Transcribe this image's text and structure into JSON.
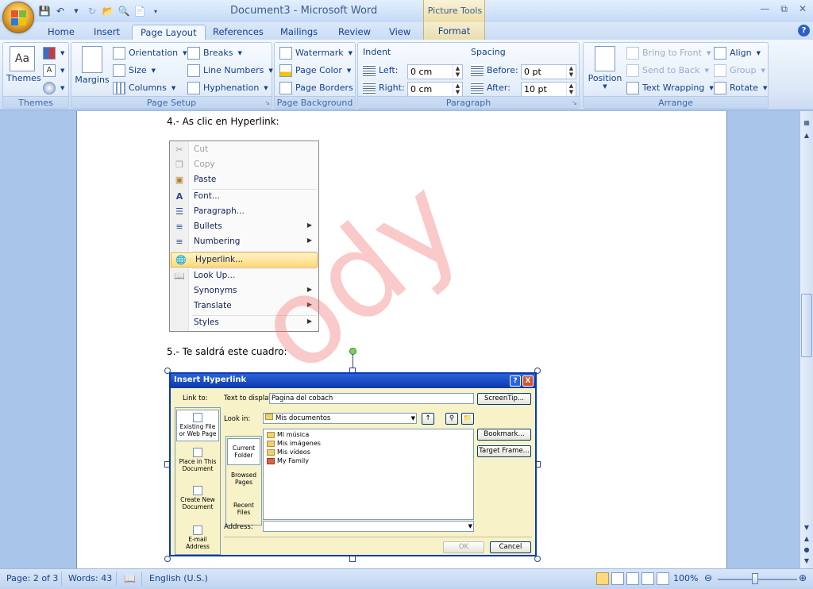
{
  "window": {
    "title": "Document3 - Microsoft Word",
    "contextual_tab_group": "Picture Tools"
  },
  "tabs": [
    "Home",
    "Insert",
    "Page Layout",
    "References",
    "Mailings",
    "Review",
    "View",
    "Format"
  ],
  "active_tab": "Page Layout",
  "ribbon": {
    "themes": {
      "label": "Themes",
      "themes_btn": "Themes"
    },
    "page_setup": {
      "label": "Page Setup",
      "margins": "Margins",
      "orientation": "Orientation",
      "size": "Size",
      "columns": "Columns",
      "breaks": "Breaks",
      "line_numbers": "Line Numbers",
      "hyphenation": "Hyphenation"
    },
    "page_background": {
      "label": "Page Background",
      "watermark": "Watermark",
      "page_color": "Page Color",
      "page_borders": "Page Borders"
    },
    "paragraph": {
      "label": "Paragraph",
      "indent": "Indent",
      "left_label": "Left:",
      "left_value": "0 cm",
      "right_label": "Right:",
      "right_value": "0 cm",
      "spacing": "Spacing",
      "before_label": "Before:",
      "before_value": "0 pt",
      "after_label": "After:",
      "after_value": "10 pt"
    },
    "arrange": {
      "label": "Arrange",
      "position": "Position",
      "bring_to_front": "Bring to Front",
      "send_to_back": "Send to Back",
      "text_wrapping": "Text Wrapping",
      "align": "Align",
      "group": "Group",
      "rotate": "Rotate"
    }
  },
  "document": {
    "step4": "4.- As clic en Hyperlink:",
    "step5": "5.- Te saldrá este cuadro:",
    "watermark_text": "ody"
  },
  "context_menu": {
    "items": [
      "Cut",
      "Copy",
      "Paste",
      "Font...",
      "Paragraph...",
      "Bullets",
      "Numbering",
      "Hyperlink...",
      "Look Up...",
      "Synonyms",
      "Translate",
      "Styles"
    ]
  },
  "dialog": {
    "title": "Insert Hyperlink",
    "help_btn": "?",
    "close_btn": "X",
    "link_to": "Link to:",
    "text_to_display_label": "Text to display:",
    "text_to_display_value": "Pagina del cobach",
    "screentip": "ScreenTip...",
    "look_in_label": "Look in:",
    "look_in_value": "Mis documentos",
    "link_to_items": [
      "Existing File or Web Page",
      "Place in This Document",
      "Create New Document",
      "E-mail Address"
    ],
    "browse_items": [
      "Current Folder",
      "Browsed Pages",
      "Recent Files"
    ],
    "files": [
      "Mi música",
      "Mis imágenes",
      "Mis vídeos",
      "My Family"
    ],
    "bookmark": "Bookmark...",
    "target_frame": "Target Frame...",
    "address_label": "Address:",
    "ok": "OK",
    "cancel": "Cancel"
  },
  "status": {
    "page": "Page: 2 of 3",
    "words": "Words: 43",
    "language": "English (U.S.)",
    "zoom": "100%"
  }
}
